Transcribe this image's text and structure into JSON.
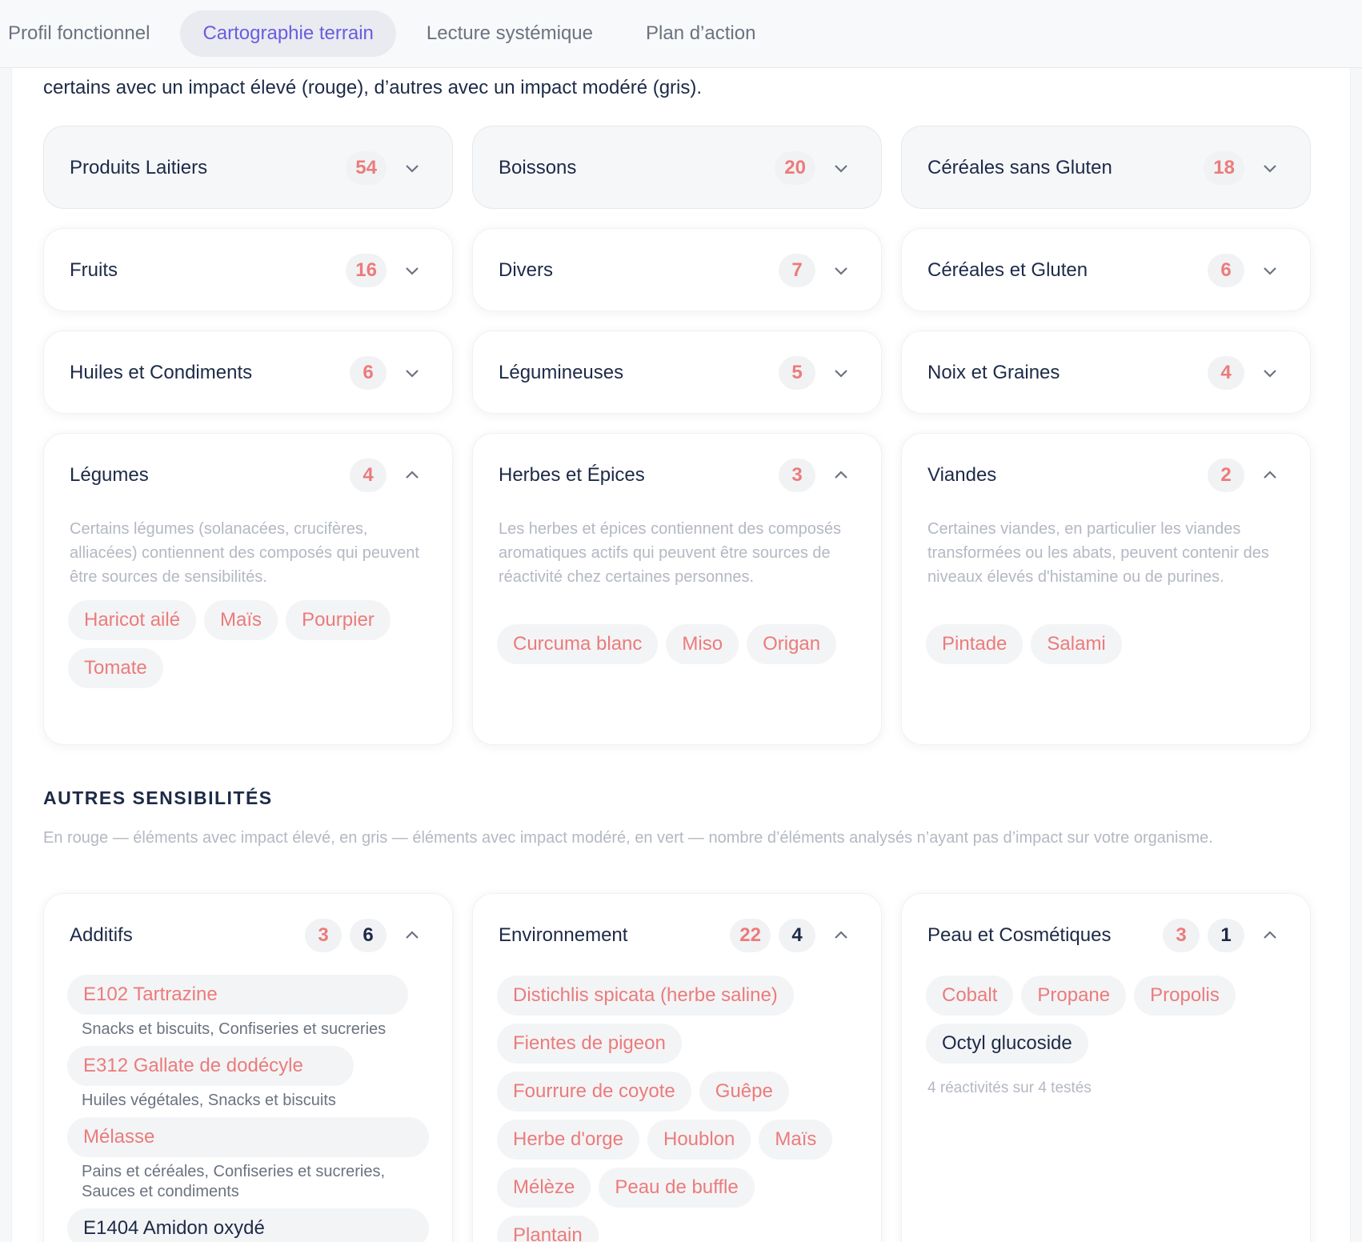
{
  "tabs": [
    {
      "label": "Profil fonctionnel"
    },
    {
      "label": "Cartographie terrain"
    },
    {
      "label": "Lecture systémique"
    },
    {
      "label": "Plan d’action"
    }
  ],
  "intro": "certains avec un impact élevé (rouge), d’autres avec un impact modéré (gris).",
  "food_categories": [
    {
      "title": "Produits Laitiers",
      "count": "54",
      "expanded": false
    },
    {
      "title": "Boissons",
      "count": "20",
      "expanded": false
    },
    {
      "title": "Céréales sans Gluten",
      "count": "18",
      "expanded": false
    },
    {
      "title": "Fruits",
      "count": "16",
      "expanded": false
    },
    {
      "title": "Divers",
      "count": "7",
      "expanded": false
    },
    {
      "title": "Céréales et Gluten",
      "count": "6",
      "expanded": false
    },
    {
      "title": "Huiles et Condiments",
      "count": "6",
      "expanded": false
    },
    {
      "title": "Légumineuses",
      "count": "5",
      "expanded": false
    },
    {
      "title": "Noix et Graines",
      "count": "4",
      "expanded": false
    },
    {
      "title": "Légumes",
      "count": "4",
      "expanded": true,
      "description": "Certains légumes (solanacées, crucifères, alliacées) contiennent des composés qui peuvent être sources de sensibilités.",
      "items": [
        "Haricot ailé",
        "Maïs",
        "Pourpier",
        "Tomate"
      ]
    },
    {
      "title": "Herbes et Épices",
      "count": "3",
      "expanded": true,
      "description": "Les herbes et épices contiennent des composés aromatiques actifs qui peuvent être sources de réactivité chez certaines personnes.",
      "items": [
        "Curcuma blanc",
        "Miso",
        "Origan"
      ]
    },
    {
      "title": "Viandes",
      "count": "2",
      "expanded": true,
      "description": "Certaines viandes, en particulier les viandes transformées ou les abats, peuvent contenir des niveaux élevés d'histamine ou de purines.",
      "items": [
        "Pintade",
        "Salami"
      ]
    }
  ],
  "other_section": {
    "title": "AUTRES SENSIBILITÉS",
    "subtitle": "En rouge — éléments avec impact élevé, en gris — éléments avec impact modéré, en vert — nombre d’éléments analysés n’ayant pas d’impact sur votre organisme."
  },
  "additifs": {
    "title": "Additifs",
    "count_high": "3",
    "count_moderate": "6",
    "items": [
      {
        "name": "E102 Tartrazine",
        "sources": "Snacks et biscuits, Confiseries et sucreries"
      },
      {
        "name": "E312 Gallate de dodécyle",
        "sources": "Huiles végétales, Snacks et biscuits"
      },
      {
        "name": "Mélasse",
        "sources": "Pains et céréales, Confiseries et sucreries, Sauces et condiments"
      },
      {
        "name": "E1404 Amidon oxydé",
        "sources": ""
      }
    ]
  },
  "environnement": {
    "title": "Environnement",
    "count_high": "22",
    "count_moderate": "4",
    "items": [
      "Distichlis spicata (herbe saline)",
      "Fientes de pigeon",
      "Fourrure de coyote",
      "Guêpe",
      "Herbe d'orge",
      "Houblon",
      "Maïs",
      "Mélèze",
      "Peau de buffle",
      "Plantain"
    ]
  },
  "peau": {
    "title": "Peau et Cosmétiques",
    "count_high": "3",
    "count_moderate": "1",
    "items_high": [
      "Cobalt",
      "Propane",
      "Propolis"
    ],
    "items_moderate": [
      "Octyl glucoside"
    ],
    "note": "4 réactivités sur 4 testés"
  },
  "colors": {
    "high": "#ec7b7b",
    "moderate": "#1d2a47",
    "accent": "#6a5ce0"
  }
}
